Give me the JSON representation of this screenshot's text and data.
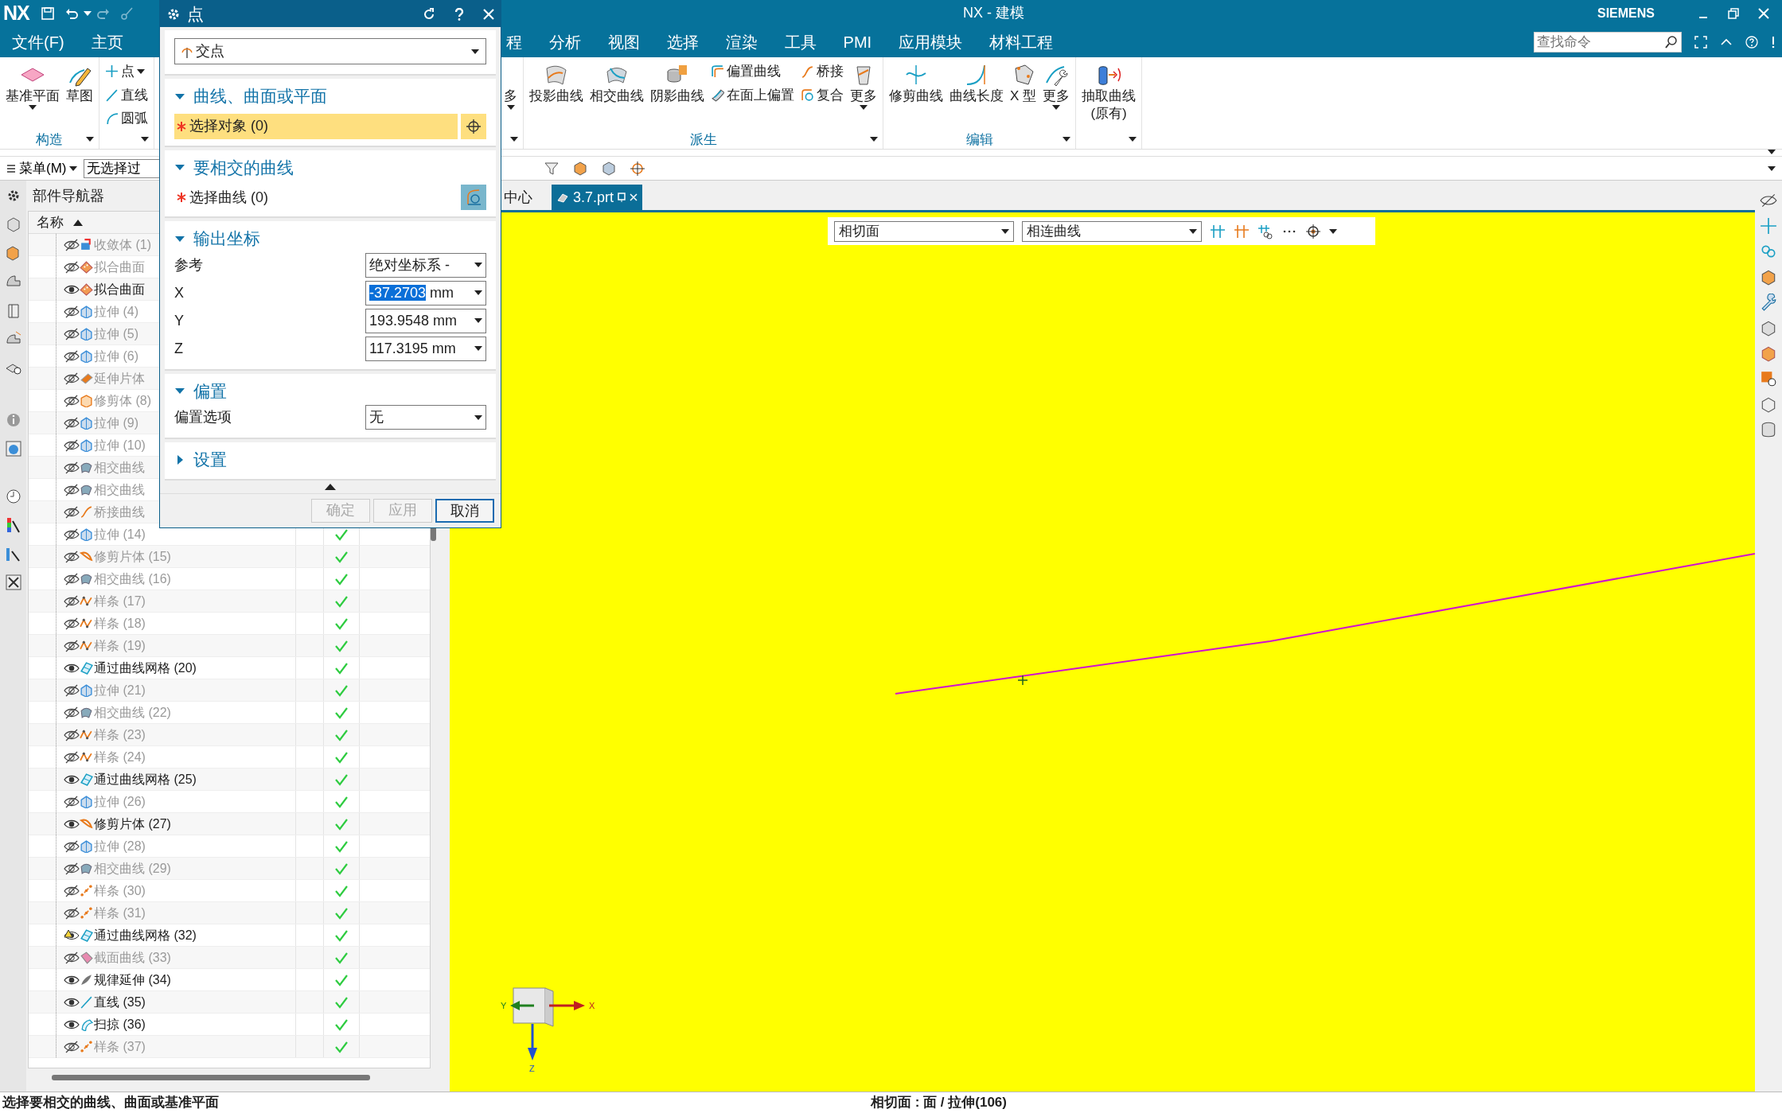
{
  "title_bar": {
    "logo": "NX",
    "title": "NX - 建模",
    "brand": "SIEMENS"
  },
  "menu_tabs": [
    {
      "label": "文件(F)"
    },
    {
      "label": "主页"
    },
    {
      "label": "程"
    },
    {
      "label": "分析"
    },
    {
      "label": "视图"
    },
    {
      "label": "选择"
    },
    {
      "label": "渲染"
    },
    {
      "label": "工具"
    },
    {
      "label": "PMI"
    },
    {
      "label": "应用模块"
    },
    {
      "label": "材料工程"
    }
  ],
  "search": {
    "placeholder": "查找命令"
  },
  "ribbon_groups": [
    {
      "label": "构造",
      "items": [
        {
          "kind": "large",
          "label": "基准平面",
          "dropdown": true
        },
        {
          "kind": "large",
          "label": "草图",
          "dropdown": false
        }
      ]
    },
    {
      "items": [
        {
          "kind": "stack",
          "items": [
            {
              "label": "点",
              "dropdown": true
            },
            {
              "label": "直线",
              "dropdown": false
            },
            {
              "label": "圆弧",
              "dropdown": false
            }
          ]
        }
      ]
    },
    {
      "items": [
        {
          "kind": "large",
          "label": "多",
          "dropdown": true
        }
      ]
    },
    {
      "label": "派生",
      "items": [
        {
          "kind": "large",
          "label": "投影曲线",
          "dropdown": false
        },
        {
          "kind": "large",
          "label": "相交曲线",
          "dropdown": false
        },
        {
          "kind": "large",
          "label": "阴影曲线",
          "dropdown": false
        },
        {
          "kind": "stack",
          "items": [
            {
              "label": "偏置曲线",
              "dropdown": false
            },
            {
              "label": "在面上偏置",
              "dropdown": false
            }
          ]
        },
        {
          "kind": "stack",
          "items": [
            {
              "label": "桥接",
              "dropdown": false
            },
            {
              "label": "复合",
              "dropdown": false
            }
          ]
        },
        {
          "kind": "large",
          "label": "更多",
          "dropdown": true
        }
      ]
    },
    {
      "label": "编辑",
      "items": [
        {
          "kind": "large",
          "label": "修剪曲线",
          "dropdown": false
        },
        {
          "kind": "large",
          "label": "曲线长度",
          "dropdown": false
        },
        {
          "kind": "large",
          "label": "X 型",
          "dropdown": false
        },
        {
          "kind": "large",
          "label": "更多",
          "dropdown": true
        }
      ]
    },
    {
      "items": [
        {
          "kind": "large",
          "label": "抽取曲线\n(原有)",
          "dropdown": false
        }
      ]
    }
  ],
  "selection_bar": {
    "menu": "菜单(M)",
    "filter": "无选择过"
  },
  "navigator": {
    "title": "部件导航器",
    "column": "名称",
    "rows": [
      {
        "label": "收敛体 (1)",
        "kind": "body",
        "shown": false,
        "warning": false
      },
      {
        "label": "拟合曲面",
        "kind": "fit",
        "shown": false,
        "warning": false
      },
      {
        "label": "拟合曲面",
        "kind": "fit",
        "shown": true,
        "warning": false
      },
      {
        "label": "拉伸 (4)",
        "kind": "extrude",
        "shown": false,
        "warning": false
      },
      {
        "label": "拉伸 (5)",
        "kind": "extrude",
        "shown": false,
        "warning": false
      },
      {
        "label": "拉伸 (6)",
        "kind": "extrude",
        "shown": false,
        "warning": false
      },
      {
        "label": "延伸片体",
        "kind": "extend",
        "shown": false,
        "warning": false
      },
      {
        "label": "修剪体 (8)",
        "kind": "trimbody",
        "shown": false,
        "warning": false
      },
      {
        "label": "拉伸 (9)",
        "kind": "extrude",
        "shown": false,
        "warning": false
      },
      {
        "label": "拉伸 (10)",
        "kind": "extrude",
        "shown": false,
        "warning": false
      },
      {
        "label": "相交曲线",
        "kind": "intersect",
        "shown": false,
        "warning": false
      },
      {
        "label": "相交曲线",
        "kind": "intersect",
        "shown": false,
        "warning": false
      },
      {
        "label": "桥接曲线",
        "kind": "bridge",
        "shown": false,
        "warning": false
      },
      {
        "label": "拉伸 (14)",
        "kind": "extrude",
        "shown": false,
        "warning": false,
        "check": true
      },
      {
        "label": "修剪片体 (15)",
        "kind": "trimsheet",
        "shown": false,
        "warning": false,
        "check": true
      },
      {
        "label": "相交曲线 (16)",
        "kind": "intersect",
        "shown": false,
        "warning": false,
        "check": true
      },
      {
        "label": "样条 (17)",
        "kind": "spline",
        "shown": false,
        "warning": false,
        "check": true
      },
      {
        "label": "样条 (18)",
        "kind": "spline",
        "shown": false,
        "warning": false,
        "check": true
      },
      {
        "label": "样条 (19)",
        "kind": "spline",
        "shown": false,
        "warning": false,
        "check": true
      },
      {
        "label": "通过曲线网格 (20)",
        "kind": "mesh",
        "shown": true,
        "warning": false,
        "check": true
      },
      {
        "label": "拉伸 (21)",
        "kind": "extrude",
        "shown": false,
        "warning": false,
        "check": true
      },
      {
        "label": "相交曲线 (22)",
        "kind": "intersect",
        "shown": false,
        "warning": false,
        "check": true
      },
      {
        "label": "样条 (23)",
        "kind": "spline",
        "shown": false,
        "warning": false,
        "check": true
      },
      {
        "label": "样条 (24)",
        "kind": "spline",
        "shown": false,
        "warning": false,
        "check": true
      },
      {
        "label": "通过曲线网格 (25)",
        "kind": "mesh",
        "shown": true,
        "warning": false,
        "check": true
      },
      {
        "label": "拉伸 (26)",
        "kind": "extrude",
        "shown": false,
        "warning": false,
        "check": true
      },
      {
        "label": "修剪片体 (27)",
        "kind": "trimsheet",
        "shown": true,
        "warning": false,
        "check": true
      },
      {
        "label": "拉伸 (28)",
        "kind": "extrude",
        "shown": false,
        "warning": false,
        "check": true
      },
      {
        "label": "相交曲线 (29)",
        "kind": "intersect",
        "shown": false,
        "warning": false,
        "check": true
      },
      {
        "label": "样条 (30)",
        "kind": "dots",
        "shown": false,
        "warning": false,
        "check": true
      },
      {
        "label": "样条 (31)",
        "kind": "dots",
        "shown": false,
        "warning": false,
        "check": true
      },
      {
        "label": "通过曲线网格 (32)",
        "kind": "mesh",
        "shown": true,
        "warning": true,
        "check": true
      },
      {
        "label": "截面曲线 (33)",
        "kind": "section",
        "shown": false,
        "warning": false,
        "check": true
      },
      {
        "label": "规律延伸 (34)",
        "kind": "law",
        "shown": true,
        "warning": false,
        "check": true
      },
      {
        "label": "直线 (35)",
        "kind": "line",
        "shown": true,
        "warning": false,
        "check": true
      },
      {
        "label": "扫掠 (36)",
        "kind": "sweep",
        "shown": true,
        "warning": false,
        "check": true
      },
      {
        "label": "样条 (37)",
        "kind": "dots",
        "shown": false,
        "warning": false,
        "check": true
      }
    ]
  },
  "graphics": {
    "tabs": [
      {
        "label": "中心",
        "selected": false
      },
      {
        "label": "3.7.prt",
        "selected": true
      }
    ],
    "toolbar": {
      "face_rule": "相切面",
      "curve_rule": "相连曲线"
    },
    "axes": {
      "x": "X",
      "y": "Y",
      "z": "Z"
    }
  },
  "dialog": {
    "title": "点",
    "type": "交点",
    "sections": [
      {
        "title": "曲线、曲面或平面",
        "expanded": true,
        "kind": "select",
        "label": "选择对象 (0)",
        "required": true,
        "active": true
      },
      {
        "title": "要相交的曲线",
        "expanded": true,
        "kind": "select",
        "label": "选择曲线 (0)",
        "required": true,
        "active": false
      },
      {
        "title": "输出坐标",
        "expanded": true,
        "kind": "fields",
        "fields": [
          {
            "label": "参考",
            "value": "绝对坐标系 -",
            "selected": false
          },
          {
            "label": "X",
            "value": "-37.2703",
            "unit": "mm",
            "selected": true
          },
          {
            "label": "Y",
            "value": "193.9548",
            "unit": "mm",
            "selected": false
          },
          {
            "label": "Z",
            "value": "117.3195",
            "unit": "mm",
            "selected": false
          }
        ]
      },
      {
        "title": "偏置",
        "expanded": true,
        "kind": "fields",
        "fields": [
          {
            "label": "偏置选项",
            "value": "无",
            "selected": false
          }
        ]
      },
      {
        "title": "设置",
        "expanded": false
      }
    ],
    "buttons": [
      {
        "label": "确定",
        "disabled": true,
        "default": false
      },
      {
        "label": "应用",
        "disabled": true,
        "default": false
      },
      {
        "label": "取消",
        "disabled": false,
        "default": true
      }
    ]
  },
  "status_bar": {
    "prompt": "选择要相交的曲线、曲面或基准平面",
    "info": "相切面 : 面 / 拉伸(106)"
  }
}
